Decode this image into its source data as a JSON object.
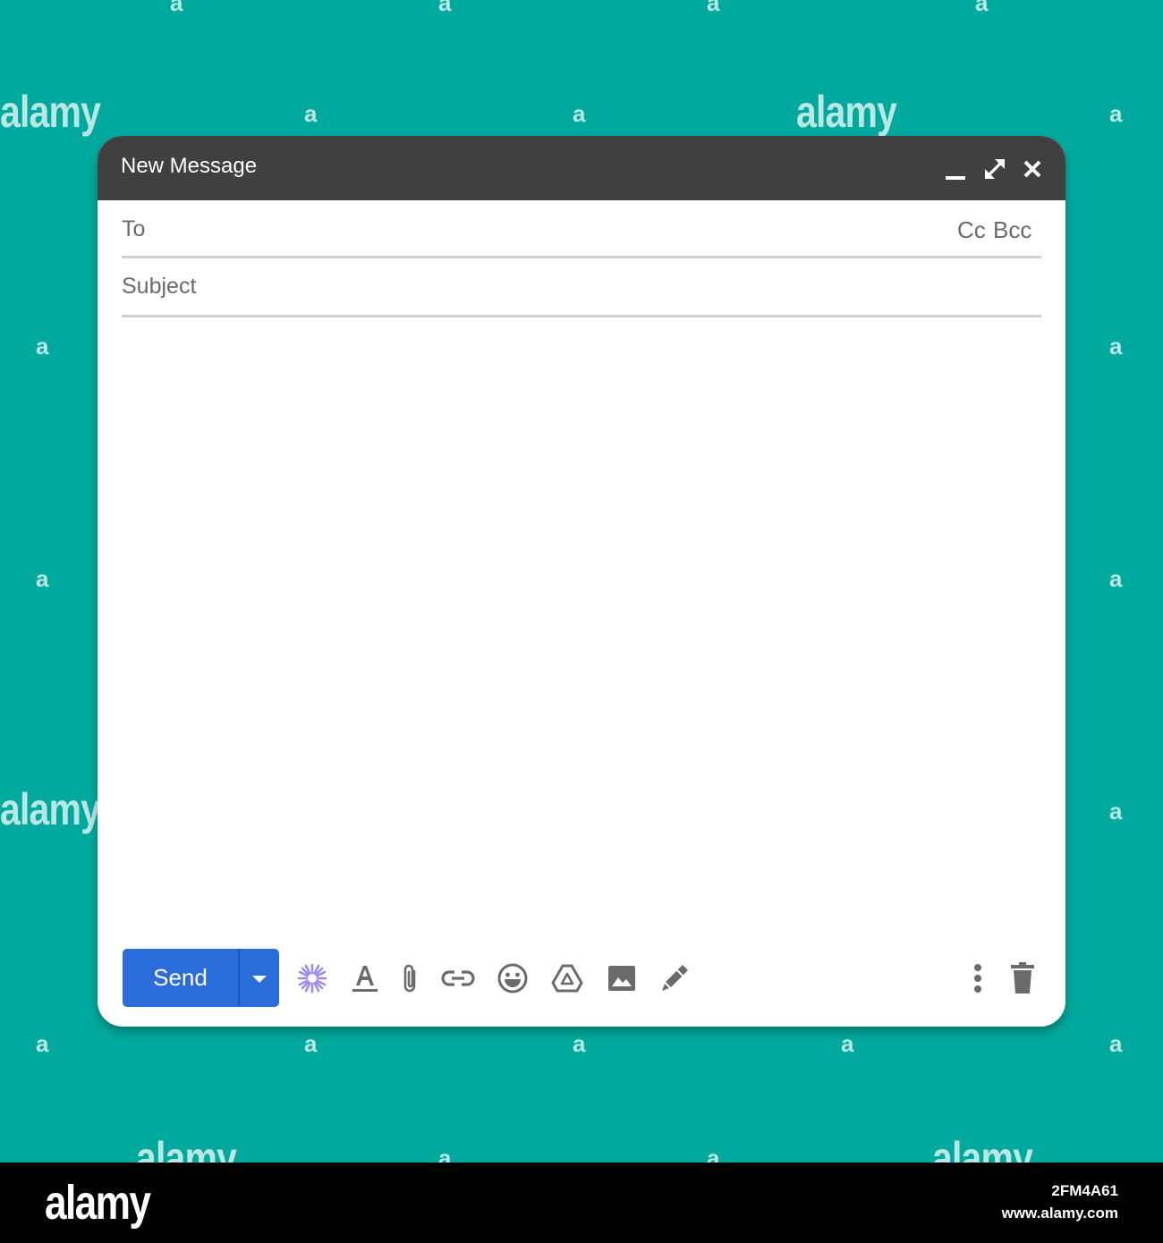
{
  "colors": {
    "background": "#00a99d",
    "titlebar": "#404040",
    "send_button": "#2b6cdb",
    "icon_gray": "#6b6b6b",
    "ai_icon": "#9b8cf0"
  },
  "window": {
    "title": "New Message",
    "controls": [
      {
        "name": "minimize",
        "icon": "minimize-icon"
      },
      {
        "name": "expand",
        "icon": "expand-icon"
      },
      {
        "name": "close",
        "icon": "close-icon"
      }
    ]
  },
  "fields": {
    "to_label": "To",
    "cc_label": "Cc",
    "bcc_label": "Bcc",
    "subject_label": "Subject"
  },
  "toolbar": {
    "send_label": "Send",
    "icons": [
      "send-options-icon",
      "ai-sparkle-icon",
      "formatting-icon",
      "attach-icon",
      "link-icon",
      "emoji-icon",
      "drive-icon",
      "photo-icon",
      "signature-icon",
      "more-options-icon",
      "discard-icon"
    ]
  },
  "watermark": {
    "text": "alamy",
    "letter": "a",
    "footer_logo": "alamy",
    "image_id": "2FM4A61",
    "url": "www.alamy.com"
  }
}
